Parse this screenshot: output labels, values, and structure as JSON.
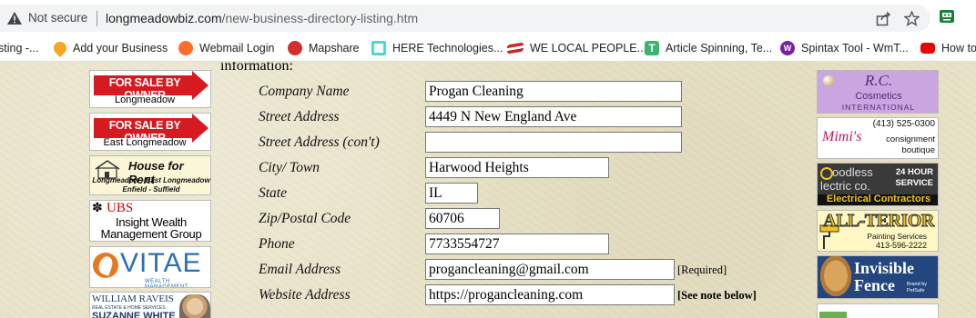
{
  "browser": {
    "security_label": "Not secure",
    "url_host": "longmeadowbiz.com",
    "url_path": "/new-business-directory-listing.htm"
  },
  "bookmarks": [
    {
      "label": "sting -...",
      "icon": "folder-icon"
    },
    {
      "label": "Add your Business",
      "icon": "map-pin-icon"
    },
    {
      "label": "Webmail Login",
      "icon": "cpanel-icon"
    },
    {
      "label": "Mapshare",
      "icon": "mapshare-icon"
    },
    {
      "label": "HERE Technologies...",
      "icon": "here-icon"
    },
    {
      "label": "WE LOCAL PEOPLE...",
      "icon": "flag-icon"
    },
    {
      "label": "Article Spinning, Te...",
      "icon": "t-icon"
    },
    {
      "label": "Spintax Tool - WmT...",
      "icon": "w-icon"
    },
    {
      "label": "How to",
      "icon": "youtube-icon"
    }
  ],
  "left_ads": {
    "sale1_top": "FOR SALE BY OWNER",
    "sale1_bottom": "Longmeadow",
    "sale2_top": "FOR SALE BY OWNER",
    "sale2_bottom": "East Longmeadow",
    "rent_title": "House for Rent",
    "rent_line1": "Longmeadow - East Longmeadow",
    "rent_line2": "Enfield - Suffield",
    "ubs_brand": "UBS",
    "ubs_line1": "Insight Wealth",
    "ubs_line2": "Management Group",
    "vitae_brand": "VITAE",
    "vitae_sub": "WEALTH MANAGEMENT",
    "raveis_name": "WILLIAM RAVEIS",
    "raveis_sub": "REAL ESTATE & HOME SERVICES",
    "raveis_agent": "SUZANNE WHITE"
  },
  "right_ads": {
    "rc_brand": "R.C.",
    "rc_line1": "Cosmetics",
    "rc_line2": "INTERNATIONAL",
    "mimis_phone": "(413) 525-0300",
    "mimis_brand": "Mimi's",
    "mimis_line1": "consignment",
    "mimis_line2": "boutique",
    "goodless_line1": "oodless",
    "goodless_line2": "lectric co.",
    "goodless_badge1": "24 HOUR",
    "goodless_badge2": "SERVICE",
    "goodless_bar": "Electrical Contractors",
    "allterior_brand": "ALL-TERIOR",
    "allterior_sub": "Painting Services",
    "allterior_phone": "413-596-2222",
    "fence_line1": "Invisible",
    "fence_line2": "Fence",
    "fence_small": "Brand by PetSafe"
  },
  "form": {
    "heading": "information:",
    "fields": [
      {
        "label": "Company Name",
        "value": "Progan Cleaning"
      },
      {
        "label": "Street Address",
        "value": "4449 N New England Ave"
      },
      {
        "label": "Street Address (con't)",
        "value": ""
      },
      {
        "label": "City/ Town",
        "value": "Harwood Heights"
      },
      {
        "label": "State",
        "value": "IL"
      },
      {
        "label": "Zip/Postal Code",
        "value": "60706"
      },
      {
        "label": "Phone",
        "value": "7733554727"
      },
      {
        "label": "Email Address",
        "value": "progancleaning@gmail.com",
        "note": "[Required]"
      },
      {
        "label": "Website Address",
        "value": "https://progancleaning.com",
        "note": "[See note below]"
      }
    ]
  }
}
